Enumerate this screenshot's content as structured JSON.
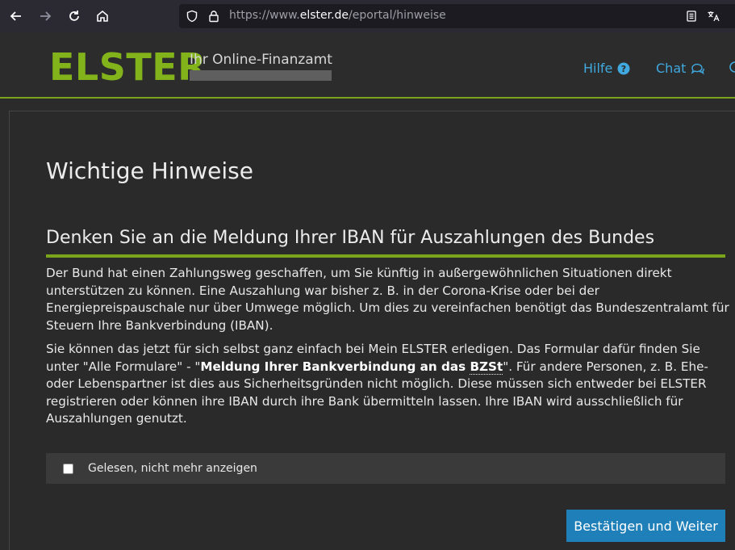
{
  "browser": {
    "url_prefix": "https://www.",
    "url_host": "elster.de",
    "url_path": "/eportal/hinweise"
  },
  "header": {
    "logo": "ELSTER",
    "tagline": "Ihr Online-Finanzamt",
    "links": [
      {
        "label": "Hilfe",
        "icon": "help-icon"
      },
      {
        "label": "Chat",
        "icon": "chat-icon"
      }
    ]
  },
  "main": {
    "page_title": "Wichtige Hinweise",
    "section_title": "Denken Sie an die Meldung Ihrer IBAN für Auszahlungen des Bundes",
    "para1": "Der Bund hat einen Zahlungsweg geschaffen, um Sie künftig in außergewöhnlichen Situationen direkt unterstützen zu können. Eine Auszahlung war bisher z. B. in der Corona-Krise oder bei der Energiepreispauschale nur über Umwege möglich. Um dies zu vereinfachen benötigt das Bundeszentralamt für Steuern Ihre Bankverbindung (IBAN).",
    "para2_a": "Sie können das jetzt für sich selbst ganz einfach bei Mein ELSTER erledigen. Das Formular dafür finden Sie unter \"Alle Formulare\" - \"",
    "para2_bold": "Meldung Ihrer Bankverbindung an das ",
    "para2_abbr": "BZSt",
    "para2_b": "\". Für andere Personen, z. B. Ehe- oder Lebenspartner ist dies aus Sicherheitsgründen nicht möglich. Diese müssen sich entweder bei ELSTER registrieren oder können ihre IBAN durch ihre Bank übermitteln lassen. Ihre IBAN wird ausschließlich für Auszahlungen genutzt.",
    "checkbox_label": "Gelesen, nicht mehr anzeigen",
    "checkbox_checked": false,
    "confirm_label": "Bestätigen und Weiter"
  },
  "colors": {
    "brand_green": "#82b31a",
    "link_blue": "#3fa9e0",
    "button_blue": "#1f7fb8"
  }
}
